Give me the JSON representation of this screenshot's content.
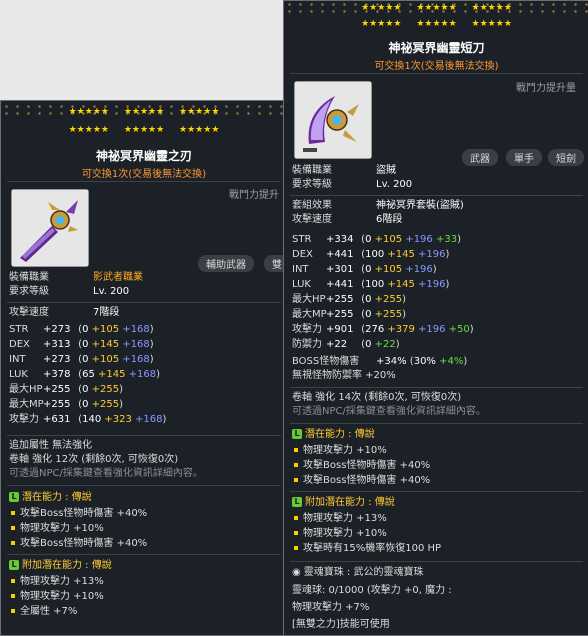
{
  "left": {
    "stars_top": [
      "★★★★★",
      "★★★★★",
      "★★★★★"
    ],
    "stars_bottom": [
      "★★★★★",
      "★★★★★",
      "★★★★★"
    ],
    "title": "神祕冥界幽靈之刃",
    "trade": "可交換1次(交易後無法交換)",
    "power_label": "戰鬥力提升",
    "tags": [
      "輔助武器",
      "雙"
    ],
    "job_label": "裝備職業",
    "job_value": "影武者職業",
    "level_label": "要求等級",
    "level_value": "Lv. 200",
    "speed_label": "攻擊速度",
    "speed_value": "7階段",
    "stats": [
      {
        "name": "STR",
        "total": "+273",
        "base": "0",
        "a": "+105",
        "b": "+168"
      },
      {
        "name": "DEX",
        "total": "+313",
        "base": "0",
        "a": "+145",
        "b": "+168"
      },
      {
        "name": "INT",
        "total": "+273",
        "base": "0",
        "a": "+105",
        "b": "+168"
      },
      {
        "name": "LUK",
        "total": "+378",
        "base": "65",
        "a": "+145",
        "b": "+168"
      },
      {
        "name": "最大HP",
        "total": "+255",
        "base": "0",
        "a": "+255",
        "b": ""
      },
      {
        "name": "最大MP",
        "total": "+255",
        "base": "0",
        "a": "+255",
        "b": ""
      },
      {
        "name": "攻擊力",
        "total": "+631",
        "base": "140",
        "a": "+323",
        "b": "+168"
      }
    ],
    "extra": "追加屬性 無法強化",
    "scroll": "卷軸 強化 12次 (剩餘0次, 可恢復0次)",
    "enhance_hint": "可透過NPC/採集鍵查看強化資訊詳細內容。",
    "potential": {
      "badge": "L",
      "title": "潛在能力 : 傳說",
      "lines": [
        "攻擊Boss怪物時傷害 +40%",
        "物理攻擊力 +10%",
        "攻擊Boss怪物時傷害 +40%"
      ]
    },
    "additional": {
      "badge": "L",
      "title": "附加潛在能力 : 傳說",
      "lines": [
        "物理攻擊力 +13%",
        "物理攻擊力 +10%",
        "全屬性 +7%"
      ]
    }
  },
  "right": {
    "stars_top": [
      "★★★★★",
      "★★★★★",
      "★★★★★"
    ],
    "stars_bottom": [
      "★★★★★",
      "★★★★★",
      "★★★★★"
    ],
    "title": "神祕冥界幽靈短刀",
    "trade": "可交換1次(交易後無法交換)",
    "power_label": "戰鬥力提升量",
    "tags": [
      "武器",
      "單手",
      "短劍"
    ],
    "job_label": "裝備職業",
    "job_value": "盜賊",
    "level_label": "要求等級",
    "level_value": "Lv. 200",
    "set_label": "套組效果",
    "set_value": "神祕冥界套裝(盜賊)",
    "speed_label": "攻擊速度",
    "speed_value": "6階段",
    "stats": [
      {
        "name": "STR",
        "total": "+334",
        "base": "0",
        "a": "+105",
        "b": "+196",
        "c": "+33"
      },
      {
        "name": "DEX",
        "total": "+441",
        "base": "100",
        "a": "+145",
        "b": "+196",
        "c": ""
      },
      {
        "name": "INT",
        "total": "+301",
        "base": "0",
        "a": "+105",
        "b": "+196",
        "c": ""
      },
      {
        "name": "LUK",
        "total": "+441",
        "base": "100",
        "a": "+145",
        "b": "+196",
        "c": ""
      },
      {
        "name": "最大HP",
        "total": "+255",
        "base": "0",
        "a": "+255",
        "b": "",
        "c": ""
      },
      {
        "name": "最大MP",
        "total": "+255",
        "base": "0",
        "a": "+255",
        "b": "",
        "c": ""
      },
      {
        "name": "攻擊力",
        "total": "+901",
        "base": "276",
        "a": "+379",
        "b": "+196",
        "c": "+50"
      },
      {
        "name": "防禦力",
        "total": "+22",
        "base": "0",
        "a": "",
        "b": "",
        "c": "+22"
      }
    ],
    "boss_line": {
      "name": "BOSS怪物傷害",
      "total": "+34%",
      "base": "30%",
      "c": "+4%"
    },
    "ignore_def": "無視怪物防禦率 +20%",
    "scroll": "卷軸 強化 14次 (剩餘0次, 可恢復0次)",
    "enhance_hint": "可透過NPC/採集鍵查看強化資訊詳細內容。",
    "potential": {
      "badge": "L",
      "title": "潛在能力 : 傳說",
      "lines": [
        "物理攻擊力 +10%",
        "攻擊Boss怪物時傷害 +40%",
        "攻擊Boss怪物時傷害 +40%"
      ]
    },
    "additional": {
      "badge": "L",
      "title": "附加潛在能力 : 傳說",
      "lines": [
        "物理攻擊力 +13%",
        "物理攻擊力 +10%",
        "攻擊時有15%機率恢復100 HP"
      ]
    },
    "soul": {
      "title": "靈魂寶珠 : 武公的靈魂寶珠",
      "line1": "靈魂球: 0/1000 (攻擊力 +0, 魔力 :",
      "line2": "物理攻擊力 +7%",
      "line3": "[無雙之力]技能可使用"
    }
  }
}
